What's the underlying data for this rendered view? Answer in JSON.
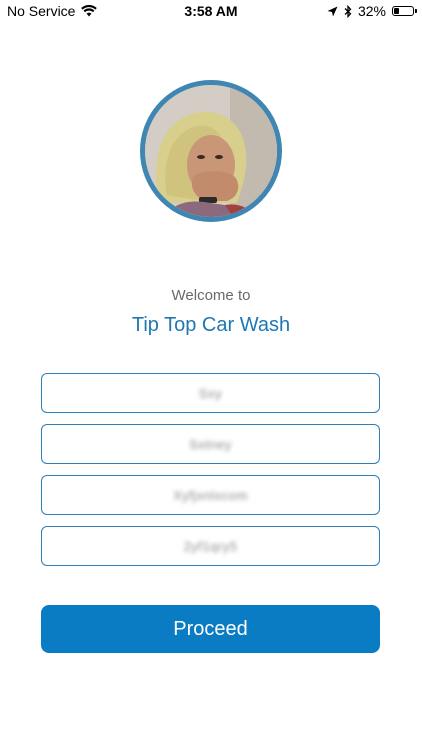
{
  "status_bar": {
    "carrier": "No Service",
    "time": "3:58 AM",
    "battery_percent": "32%",
    "battery_level": 0.32,
    "icons": [
      "wifi-icon",
      "location-icon",
      "bluetooth-icon",
      "battery-icon"
    ]
  },
  "profile": {
    "avatar_border_color": "#3f86b3"
  },
  "welcome": {
    "greeting": "Welcome to",
    "business_name": "Tip Top Car Wash"
  },
  "form": {
    "fields": [
      {
        "value": "Sxy"
      },
      {
        "value": "Sxtney"
      },
      {
        "value": "Xyfjxnlxcom"
      },
      {
        "value": "2yf1qry5"
      }
    ]
  },
  "actions": {
    "proceed_label": "Proceed"
  },
  "colors": {
    "accent": "#0a7cc3",
    "title_text": "#1f78b4",
    "field_border": "#2d7fb5"
  }
}
